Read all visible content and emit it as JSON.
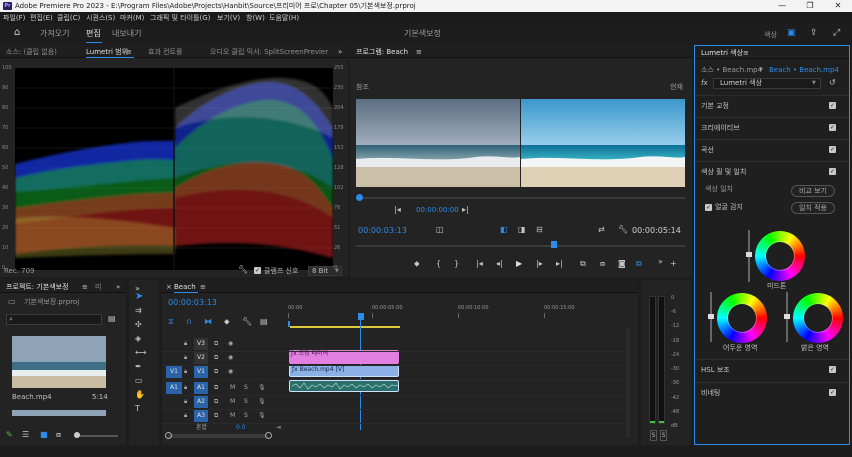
{
  "window": {
    "app_icon": "Pr",
    "title": "Adobe Premiere Pro 2023 - E:\\Program Files\\Adobe\\Projects\\Hanbit\\Source\\프리미어 프로\\Chapter 05\\기본색보정.prproj",
    "controls": [
      "—",
      "❐",
      "✕"
    ]
  },
  "menu": [
    "파일(F)",
    "편집(E)",
    "클립(C)",
    "시퀀스(S)",
    "마커(M)",
    "그래픽 및 타이틀(G)",
    "보기(V)",
    "창(W)",
    "도움말(H)"
  ],
  "workspace": {
    "tabs": [
      "가져오기",
      "편집",
      "내보내기"
    ],
    "active": "편집",
    "center_title": "기본색보정",
    "right_label": "색상"
  },
  "source_panel": {
    "tabs": [
      "소스: (클립 없음)",
      "Lumetri 범위",
      "효과 컨트롤",
      "오디오 클립 믹서: SplitScreenPrevier"
    ],
    "active": "Lumetri 범위",
    "left_scale": [
      "100",
      "90",
      "80",
      "70",
      "60",
      "50",
      "40",
      "30",
      "20",
      "10",
      "0"
    ],
    "right_scale": [
      "255",
      "230",
      "204",
      "178",
      "153",
      "128",
      "102",
      "76",
      "51",
      "26",
      "0"
    ],
    "footer_left": "Rec. 709",
    "footer_clamp": "클램프 신호",
    "footer_bits": "8 Bit"
  },
  "program_panel": {
    "title": "프로그램: Beach",
    "label_reference": "참조",
    "label_current": "현재",
    "ref_timecode": "00:00:00:00",
    "timecode": "00:00:03:13",
    "duration": "00:00:05:14",
    "playhead_fraction": 0.6
  },
  "project_panel": {
    "tabs": [
      "프로젝트: 기본색보정",
      "미"
    ],
    "file": "기본색보정.prproj",
    "clip_name": "Beach.mp4",
    "clip_duration": "5:14"
  },
  "timeline": {
    "tab": "Beach",
    "timecode": "00:00:03:13",
    "ruler": [
      "00:00",
      "00:00:05:00",
      "00:00:10:00",
      "00:00:15:00"
    ],
    "video_tracks": [
      "V3",
      "V2",
      "V1"
    ],
    "audio_tracks": [
      "A1",
      "A2",
      "A3"
    ],
    "source_patch_video": "V1",
    "source_patch_audio": "A1",
    "master_label": "혼합",
    "master_value": "0.0",
    "clip_adjustment": "조정 레이어",
    "clip_beach": "Beach.mp4 [V]",
    "colors": {
      "adjustment": "#e27fe0",
      "video": "#8bb0e6",
      "audio": "#2c6f6a"
    }
  },
  "meters": {
    "scale": [
      "0",
      "-6",
      "-12",
      "-18",
      "-24",
      "-30",
      "-36",
      "-42",
      "-48",
      "dB"
    ],
    "solo": [
      "S",
      "S"
    ]
  },
  "lumetri": {
    "tab": "Lumetri 색상",
    "source_clip": "소스 • Beach.mp4",
    "seq_clip": "Beach • Beach.mp4",
    "fx_label": "fx",
    "effect_name": "Lumetri 색상",
    "sections": [
      "기본 교정",
      "크리에이티브",
      "곡선",
      "색상 휠 및 일치"
    ],
    "color_match": "색상 일치",
    "compare_button": "비교 보기",
    "face_detect": "얼굴 감지",
    "apply_button": "일치 적용",
    "wheels": [
      "미드톤",
      "어두운 영역",
      "밝은 영역"
    ],
    "lower_sections": [
      "HSL 보조",
      "비네팅"
    ]
  }
}
